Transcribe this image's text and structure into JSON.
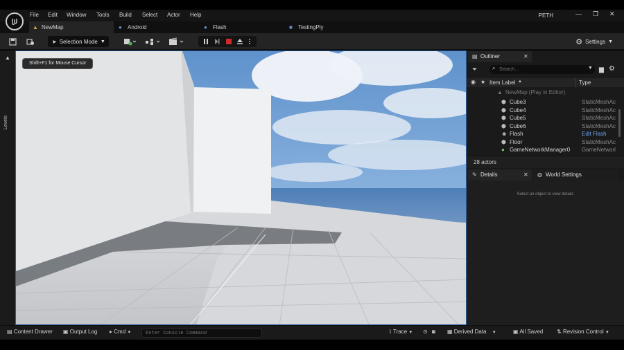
{
  "menu": {
    "items": [
      "File",
      "Edit",
      "Window",
      "Tools",
      "Build",
      "Select",
      "Actor",
      "Help"
    ],
    "project_name": "PETH",
    "minimize": "—",
    "maximize": "❐",
    "close": "✕"
  },
  "tabs": [
    {
      "label": "NewMap",
      "icon": "map-icon"
    },
    {
      "label": "Android",
      "icon": "person-icon"
    },
    {
      "label": "Flash",
      "icon": "person-icon"
    },
    {
      "label": "TestingPly",
      "icon": "blueprint-icon"
    }
  ],
  "toolbar": {
    "selection_mode": "Selection Mode",
    "settings": "Settings"
  },
  "levels_label": "Levels",
  "viewport": {
    "hint": "Shift+F1 for Mouse Cursor"
  },
  "outliner": {
    "title": "Outliner",
    "search_placeholder": "Search...",
    "col_item_label": "Item Label",
    "col_type": "Type",
    "map_label": "NewMap (Play in Editor)",
    "rows": [
      {
        "name": "Cube3",
        "type": "StaticMeshAc",
        "icon": "cube-icon"
      },
      {
        "name": "Cube4",
        "type": "StaticMeshAc",
        "icon": "cube-icon"
      },
      {
        "name": "Cube5",
        "type": "StaticMeshAc",
        "icon": "cube-icon"
      },
      {
        "name": "Cube6",
        "type": "StaticMeshAc",
        "icon": "cube-icon"
      },
      {
        "name": "Flash",
        "type": "Edit Flash",
        "icon": "person-icon",
        "type_is_link": true
      },
      {
        "name": "Floor",
        "type": "StaticMeshAc",
        "icon": "cube-icon"
      },
      {
        "name": "GameNetworkManager0",
        "type": "GameNetworl",
        "icon": "network-icon"
      }
    ],
    "actor_count": "28 actors"
  },
  "details": {
    "tab_details": "Details",
    "tab_world": "World Settings",
    "empty_message": "Select an object to view details"
  },
  "statusbar": {
    "content_drawer": "Content Drawer",
    "output_log": "Output Log",
    "cmd": "Cmd",
    "console_placeholder": "Enter Console Command",
    "trace": "Trace",
    "derived_data": "Derived Data",
    "all_saved": "All Saved",
    "revision_control": "Revision Control"
  },
  "colors": {
    "accent_blue": "#2c5fa0",
    "stop_red": "#d02a2a",
    "link_blue": "#6ea8f0",
    "panel_bg": "#1a1a1a"
  }
}
